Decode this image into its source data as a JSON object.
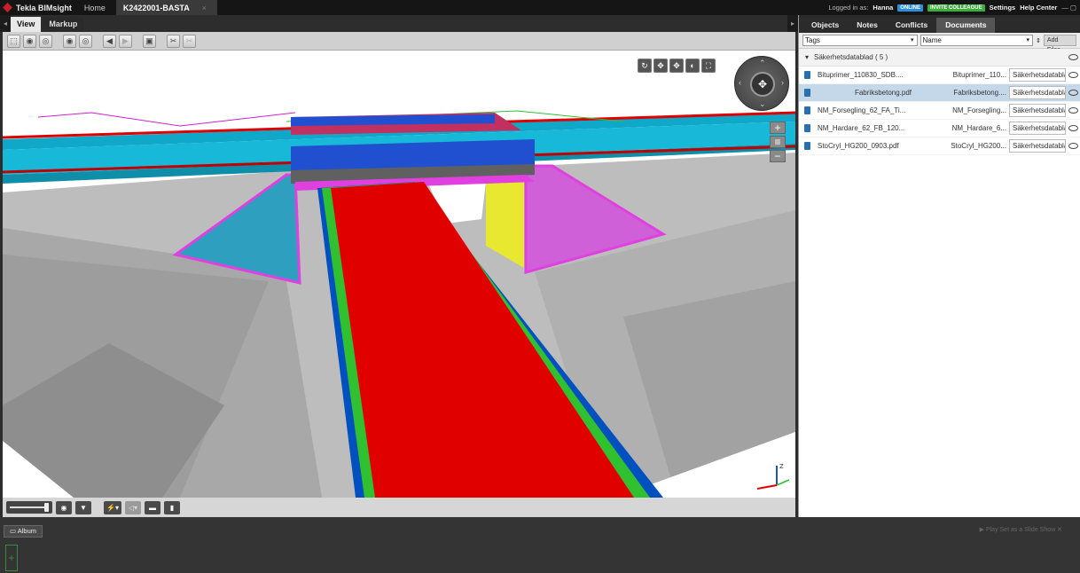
{
  "app": {
    "title": "Tekla BIMsight",
    "home": "Home",
    "project_tab": "K2422001-BASTA",
    "close": "×"
  },
  "user": {
    "logged_in": "Logged in as:",
    "name": "Hanna",
    "online": "ONLINE",
    "invite": "INVITE COLLEAGUE",
    "settings": "Settings",
    "help": "Help Center"
  },
  "view_tabs": [
    "View",
    "Markup"
  ],
  "right_tabs": [
    "Objects",
    "Notes",
    "Conflicts",
    "Documents"
  ],
  "filters": {
    "tags": "Tags",
    "name": "Name",
    "add_files": "Add Files"
  },
  "documents": {
    "group": "Säkerhetsdatablad ( 5 )",
    "rows": [
      {
        "file": "Bituprimer_110830_SDB....",
        "title": "Bituprimer_110...",
        "tag": "Säkerhetsdatablad"
      },
      {
        "file": "Fabriksbetong.pdf",
        "title": "Fabriksbetong....",
        "tag": "Säkerhetsdatablad"
      },
      {
        "file": "NM_Forsegling_62_FA_Ti...",
        "title": "NM_Forsegling...",
        "tag": "Säkerhetsdatablad"
      },
      {
        "file": "NM_Hardare_62_FB_120...",
        "title": "NM_Hardare_6...",
        "tag": "Säkerhetsdatablad"
      },
      {
        "file": "StoCryl_HG200_0903.pdf",
        "title": "StoCryl_HG200...",
        "tag": "Säkerhetsdatablad"
      }
    ]
  },
  "album": {
    "label": "Album",
    "slideshow": "Play Set as a Slide Show"
  },
  "colors": {
    "road": "#e00000",
    "blue_edge": "#0040d0",
    "green_edge": "#30c030",
    "rail_teal": "#10a8c8",
    "magenta": "#d84ad8",
    "yellow": "#e8e830"
  }
}
